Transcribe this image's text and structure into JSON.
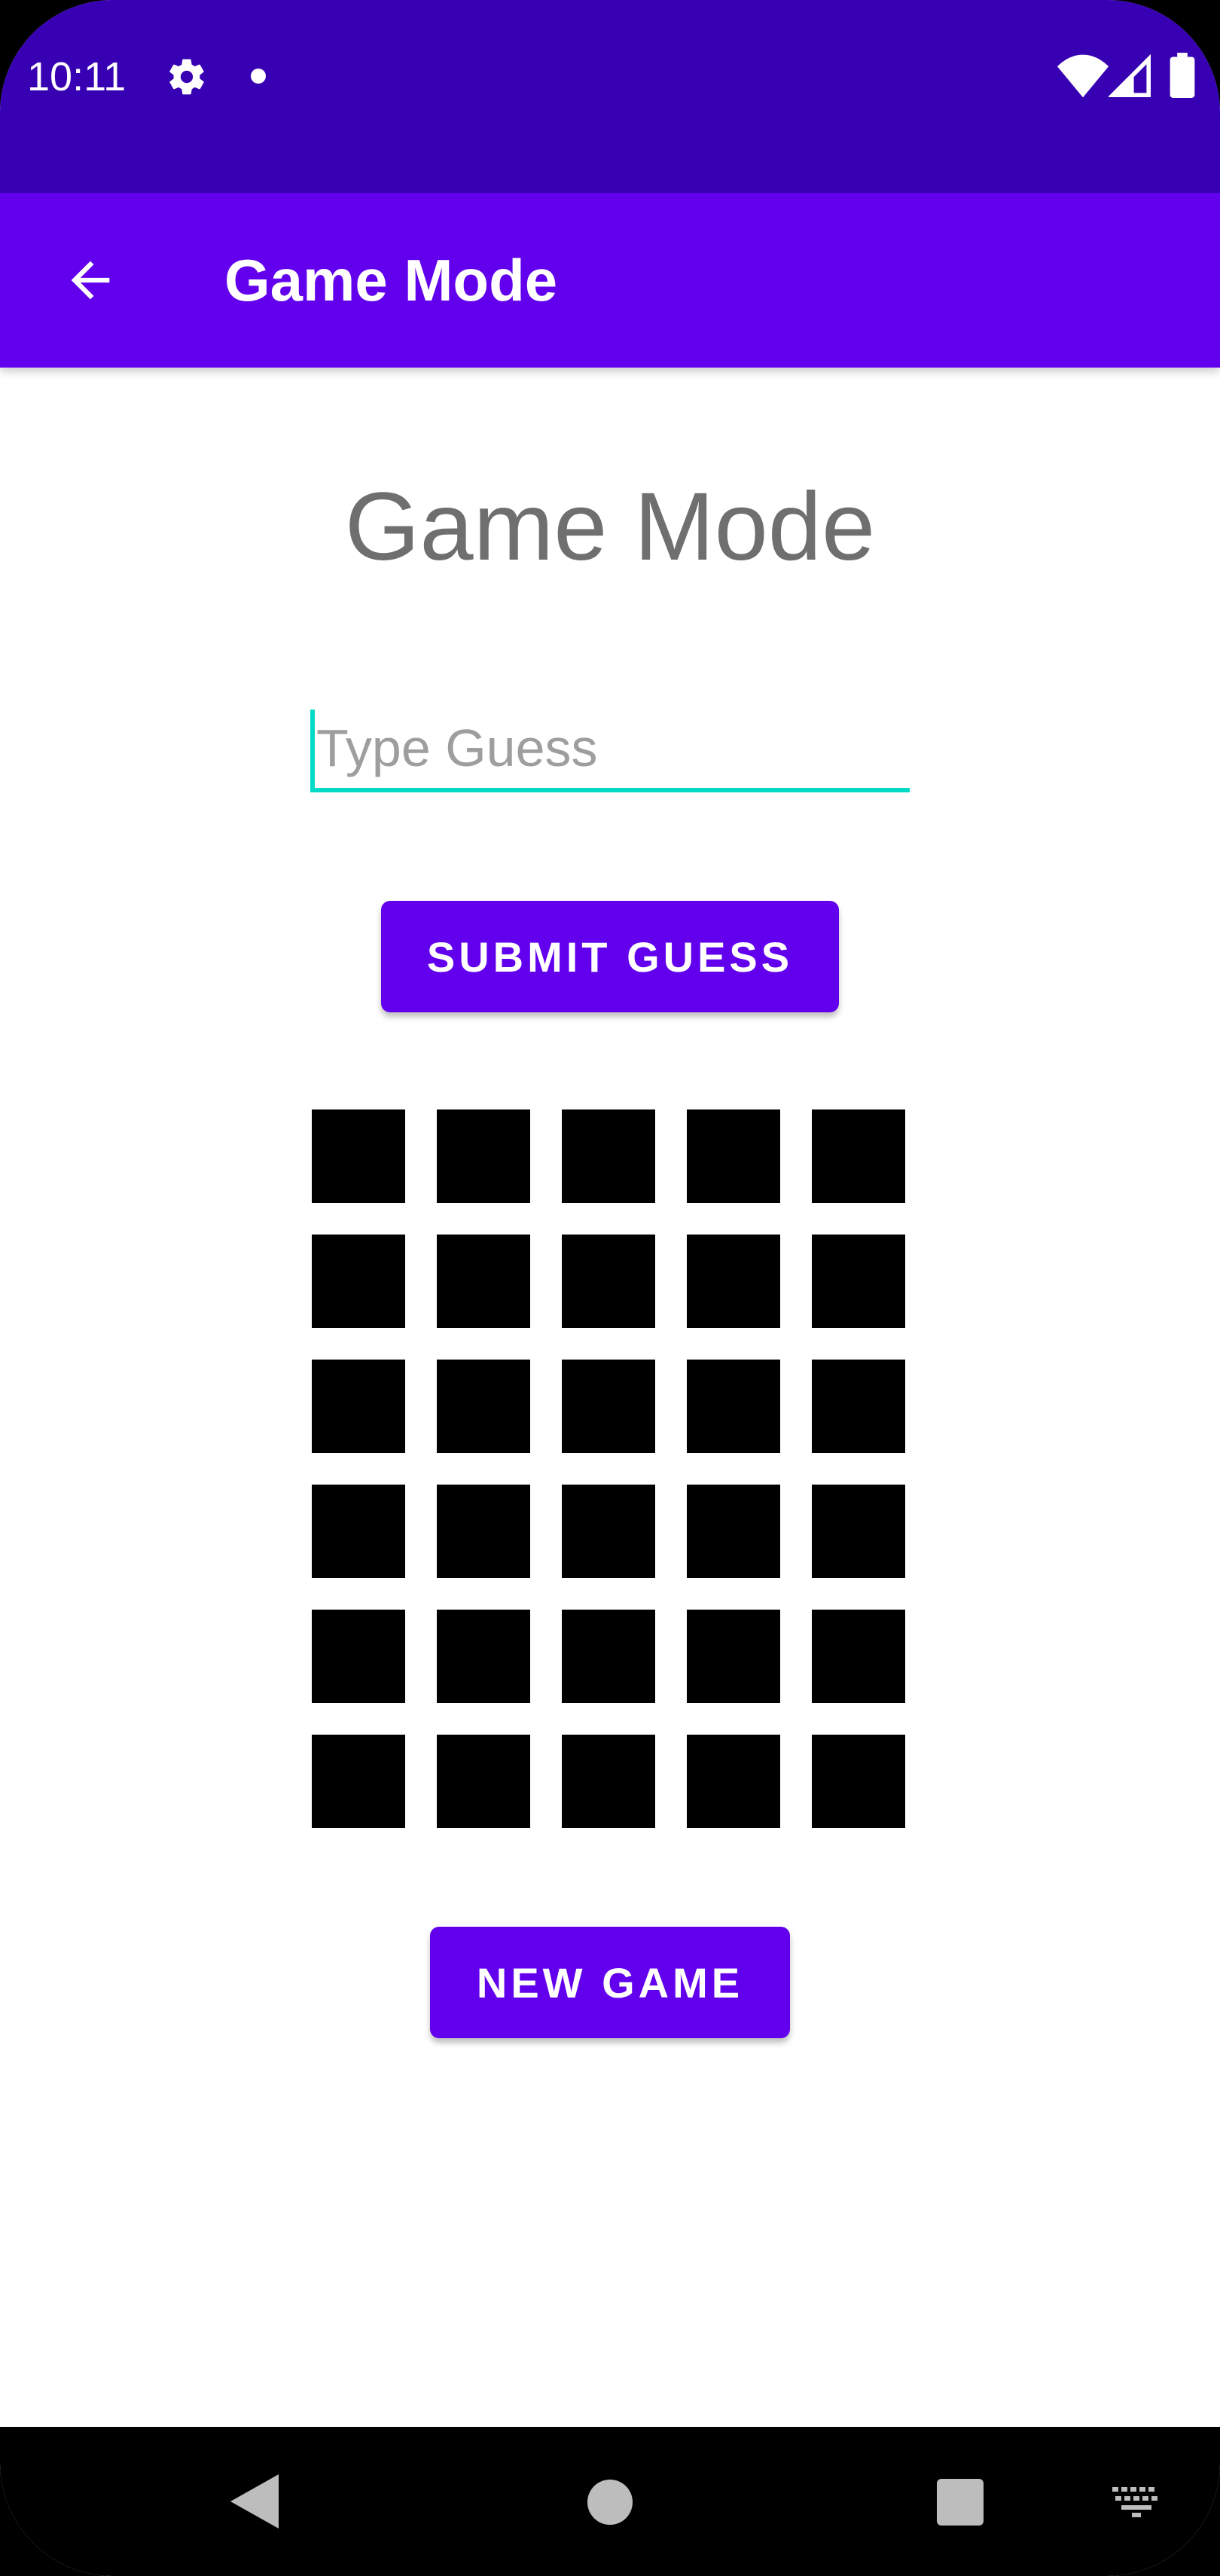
{
  "status_bar": {
    "time": "10:11",
    "icons": [
      "gear-icon",
      "notification-dot-icon",
      "wifi-icon",
      "signal-icon",
      "battery-icon"
    ]
  },
  "app_bar": {
    "title": "Game Mode",
    "back_icon": "arrow-left-icon",
    "background_color": "#6200EE"
  },
  "main": {
    "heading": "Game Mode",
    "guess_input": {
      "value": "",
      "placeholder": "Type Guess"
    },
    "submit_label": "SUBMIT GUESS",
    "board": {
      "rows": 6,
      "columns": 5,
      "cell_color": "#000000"
    },
    "new_game_label": "NEW GAME"
  },
  "nav_bar": {
    "icons": [
      "back-triangle-icon",
      "home-circle-icon",
      "recents-square-icon",
      "keyboard-icon"
    ]
  },
  "colors": {
    "status_bar": "#3700B3",
    "primary": "#6200EE",
    "accent": "#03DAC5",
    "heading_text": "#6f6f6f"
  }
}
